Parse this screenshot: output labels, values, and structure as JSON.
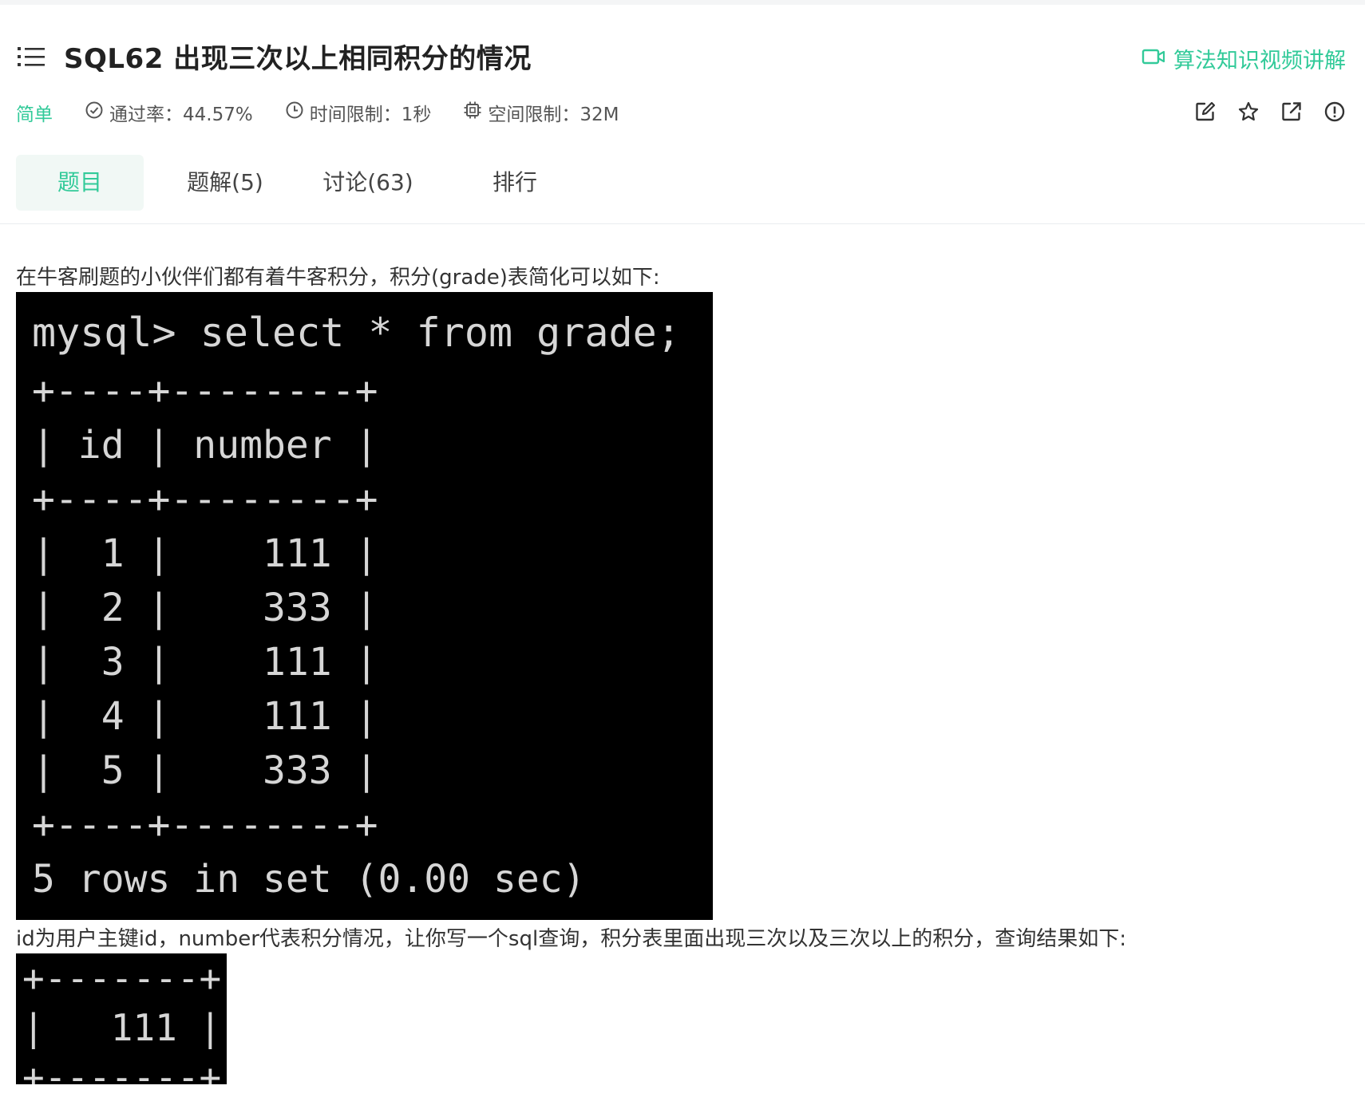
{
  "colors": {
    "accent": "#32ca99",
    "terminal_bg": "#000000",
    "terminal_text": "#d6d6d6"
  },
  "header": {
    "title": "SQL62  出现三次以上相同积分的情况",
    "video_link": "算法知识视频讲解",
    "difficulty": "简单",
    "pass_rate": "通过率：44.57%",
    "time_limit": "时间限制：1秒",
    "space_limit": "空间限制：32M"
  },
  "icons": {
    "menu": "list-menu-icon",
    "video": "video-camera-icon",
    "pass_rate": "check-circle-icon",
    "time": "clock-icon",
    "space": "chip-icon",
    "actions": [
      "edit-icon",
      "star-icon",
      "share-icon",
      "report-icon"
    ]
  },
  "tabs": [
    {
      "label": "题目",
      "active": true
    },
    {
      "label": "题解(5)",
      "active": false
    },
    {
      "label": "讨论(63)",
      "active": false
    },
    {
      "label": "排行",
      "active": false
    }
  ],
  "content": {
    "intro": "在牛客刷题的小伙伴们都有着牛客积分，积分(grade)表简化可以如下:",
    "terminal_lines": [
      "mysql> select * from grade;",
      "+----+--------+",
      "| id | number |",
      "+----+--------+",
      "|  1 |    111 |",
      "|  2 |    333 |",
      "|  3 |    111 |",
      "|  4 |    111 |",
      "|  5 |    333 |",
      "+----+--------+",
      "5 rows in set (0.00 sec)"
    ],
    "description": "id为用户主键id，number代表积分情况，让你写一个sql查询，积分表里面出现三次以及三次以上的积分，查询结果如下:",
    "result_lines": [
      "+-------+",
      "|   111 |",
      "+-------+"
    ]
  }
}
